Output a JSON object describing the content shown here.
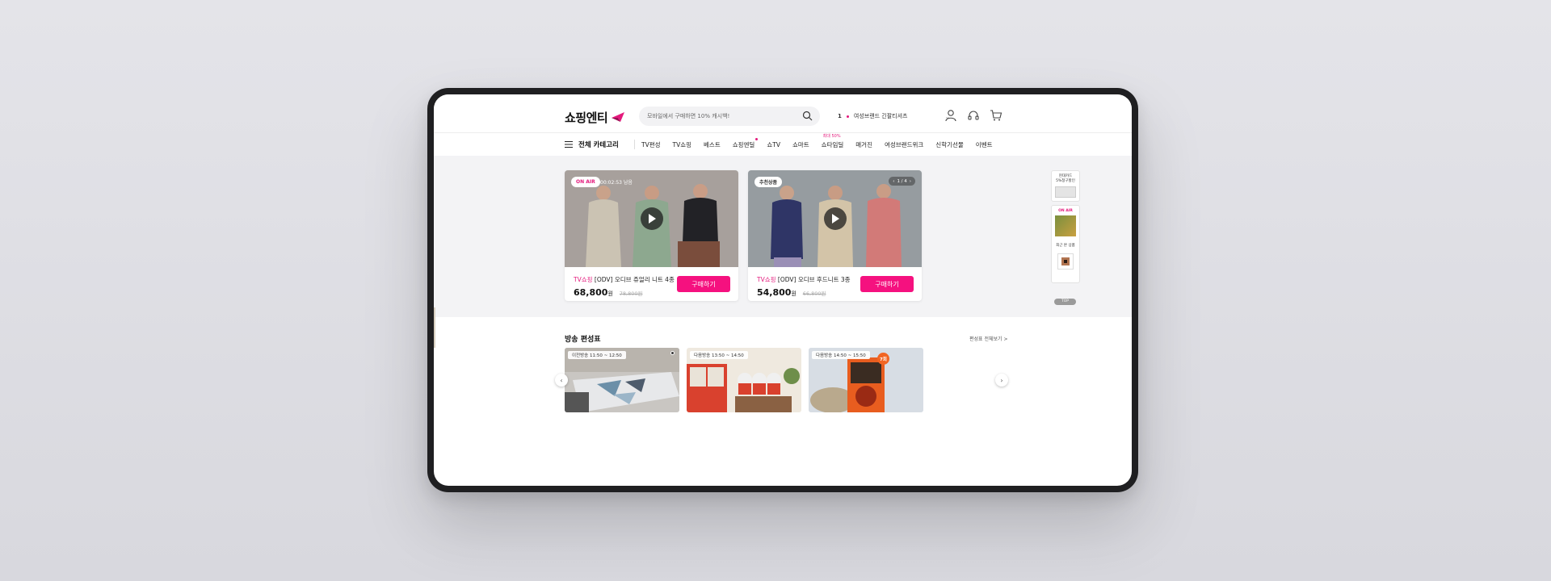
{
  "header": {
    "logo_text": "쇼핑엔티",
    "search_placeholder": "모바일에서 구매하면 10% 캐시백!",
    "promo_rank": "1",
    "promo_text": "여성브랜드 긴팔티셔츠"
  },
  "nav": {
    "category_label": "전체 카테고리",
    "items": [
      {
        "label": "TV편성"
      },
      {
        "label": "TV쇼핑"
      },
      {
        "label": "베스트"
      },
      {
        "label": "쇼핑엔딜"
      },
      {
        "label": "쇼TV"
      },
      {
        "label": "쇼마트"
      },
      {
        "label": "쇼타임딜",
        "badge": "최대 50%"
      },
      {
        "label": "매거진"
      },
      {
        "label": "여성브랜드위크"
      },
      {
        "label": "신학기선물"
      },
      {
        "label": "이벤트"
      }
    ]
  },
  "banners": [
    {
      "tag": "ON AIR",
      "timer": "00:02:53 남음",
      "brand": "TV쇼핑",
      "title": "[ODV] 오디브 쥬얼리 니트 4종",
      "price": "68,800",
      "won": "원",
      "orig_price": "78,800원",
      "buy_label": "구매하기"
    },
    {
      "tag": "추천상품",
      "pager": "1 / 4",
      "brand": "TV쇼핑",
      "title": "[ODV] 오디브 후드니트 3종",
      "price": "54,800",
      "won": "원",
      "orig_price": "66,800원",
      "buy_label": "구매하기"
    }
  ],
  "side": {
    "card_promo_line1": "현대카드",
    "card_promo_line2": "5%청구할인",
    "onair": "ON AIR",
    "recent": "최근 본 상품",
    "top": "TOP"
  },
  "schedule": {
    "title": "방송 편성표",
    "more": "편성표 전체보기 >",
    "items": [
      {
        "label": "이전방송 11:50 ~ 12:50"
      },
      {
        "label": "다음방송 13:50 ~ 14:50"
      },
      {
        "label": "다음방송 14:50 ~ 15:50",
        "badge": "7회"
      }
    ]
  },
  "colors": {
    "accent": "#f5117f",
    "onair": "#e4197c"
  }
}
